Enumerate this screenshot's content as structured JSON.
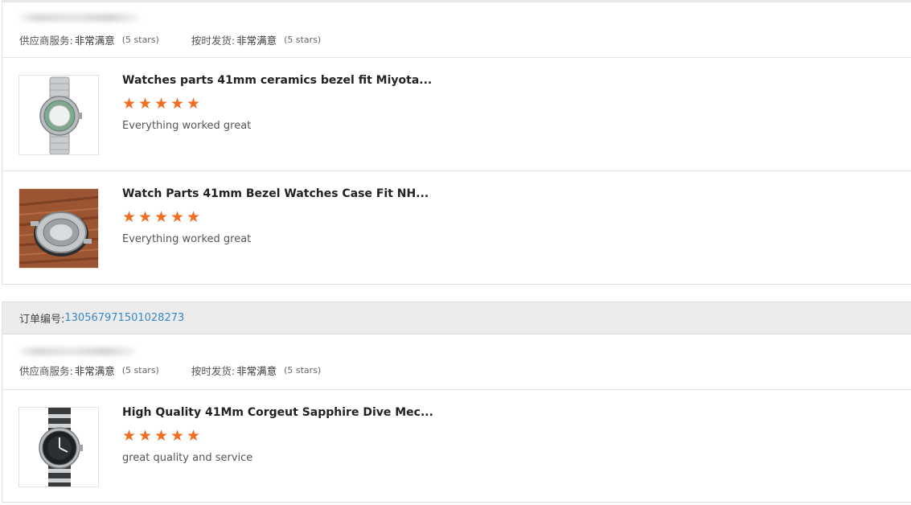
{
  "orders": [
    {
      "service_label": "供应商服务:",
      "service_value": "非常满意",
      "service_stars": "(5 stars)",
      "shipping_label": "按时发货:",
      "shipping_value": "非常满意",
      "shipping_stars": "(5 stars)",
      "items": [
        {
          "title": "Watches parts 41mm ceramics bezel fit Miyota...",
          "rating": 5,
          "comment": "Everything worked great",
          "thumb_icon": "steel-watch-icon"
        },
        {
          "title": "Watch Parts 41mm Bezel Watches Case Fit NH...",
          "rating": 5,
          "comment": "Everything worked great",
          "thumb_icon": "watch-case-icon"
        }
      ]
    },
    {
      "order_label": "订单编号:",
      "order_number": "130567971501028273",
      "service_label": "供应商服务:",
      "service_value": "非常满意",
      "service_stars": "(5 stars)",
      "shipping_label": "按时发货:",
      "shipping_value": "非常满意",
      "shipping_stars": "(5 stars)",
      "items": [
        {
          "title": "High Quality 41Mm Corgeut Sapphire Dive Mec...",
          "rating": 5,
          "comment": "great quality and service",
          "thumb_icon": "nato-strap-watch-icon"
        }
      ]
    }
  ],
  "colors": {
    "star": "#f26c22",
    "link": "#3a87c8",
    "header_bg": "#ececec"
  }
}
